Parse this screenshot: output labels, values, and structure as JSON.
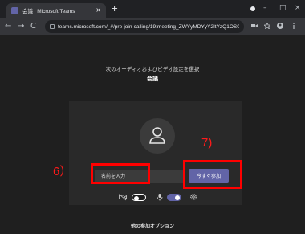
{
  "browser": {
    "tab_title": "会議 | Microsoft Teams",
    "tab_close": "×",
    "new_tab": "+",
    "minimize": "–",
    "maximize": "□",
    "close": "×",
    "back": "←",
    "forward": "→",
    "reload": "C",
    "url": "teams.microsoft.com/_#/pre-join-calling/19:meeting_ZWYyMDYyY2ItYzQ1OS0..."
  },
  "prejoin": {
    "prompt": "次のオーディオおよびビデオ設定を選択",
    "meeting_name": "会議",
    "name_placeholder": "名前を入力",
    "join_button": "今すぐ参加",
    "video_on": false,
    "mic_on": true,
    "other_options": "他の参加オプション"
  },
  "annotations": {
    "step6": "6）",
    "step7": "7)"
  },
  "colors": {
    "accent": "#6264a7",
    "annotation": "#ff0000",
    "page_background": "#1f1f1f",
    "card_background": "#292929"
  },
  "icons": [
    "teams-favicon",
    "lock-icon",
    "avatar-person-icon",
    "camera-off-icon",
    "mic-icon",
    "settings-gear-icon"
  ]
}
